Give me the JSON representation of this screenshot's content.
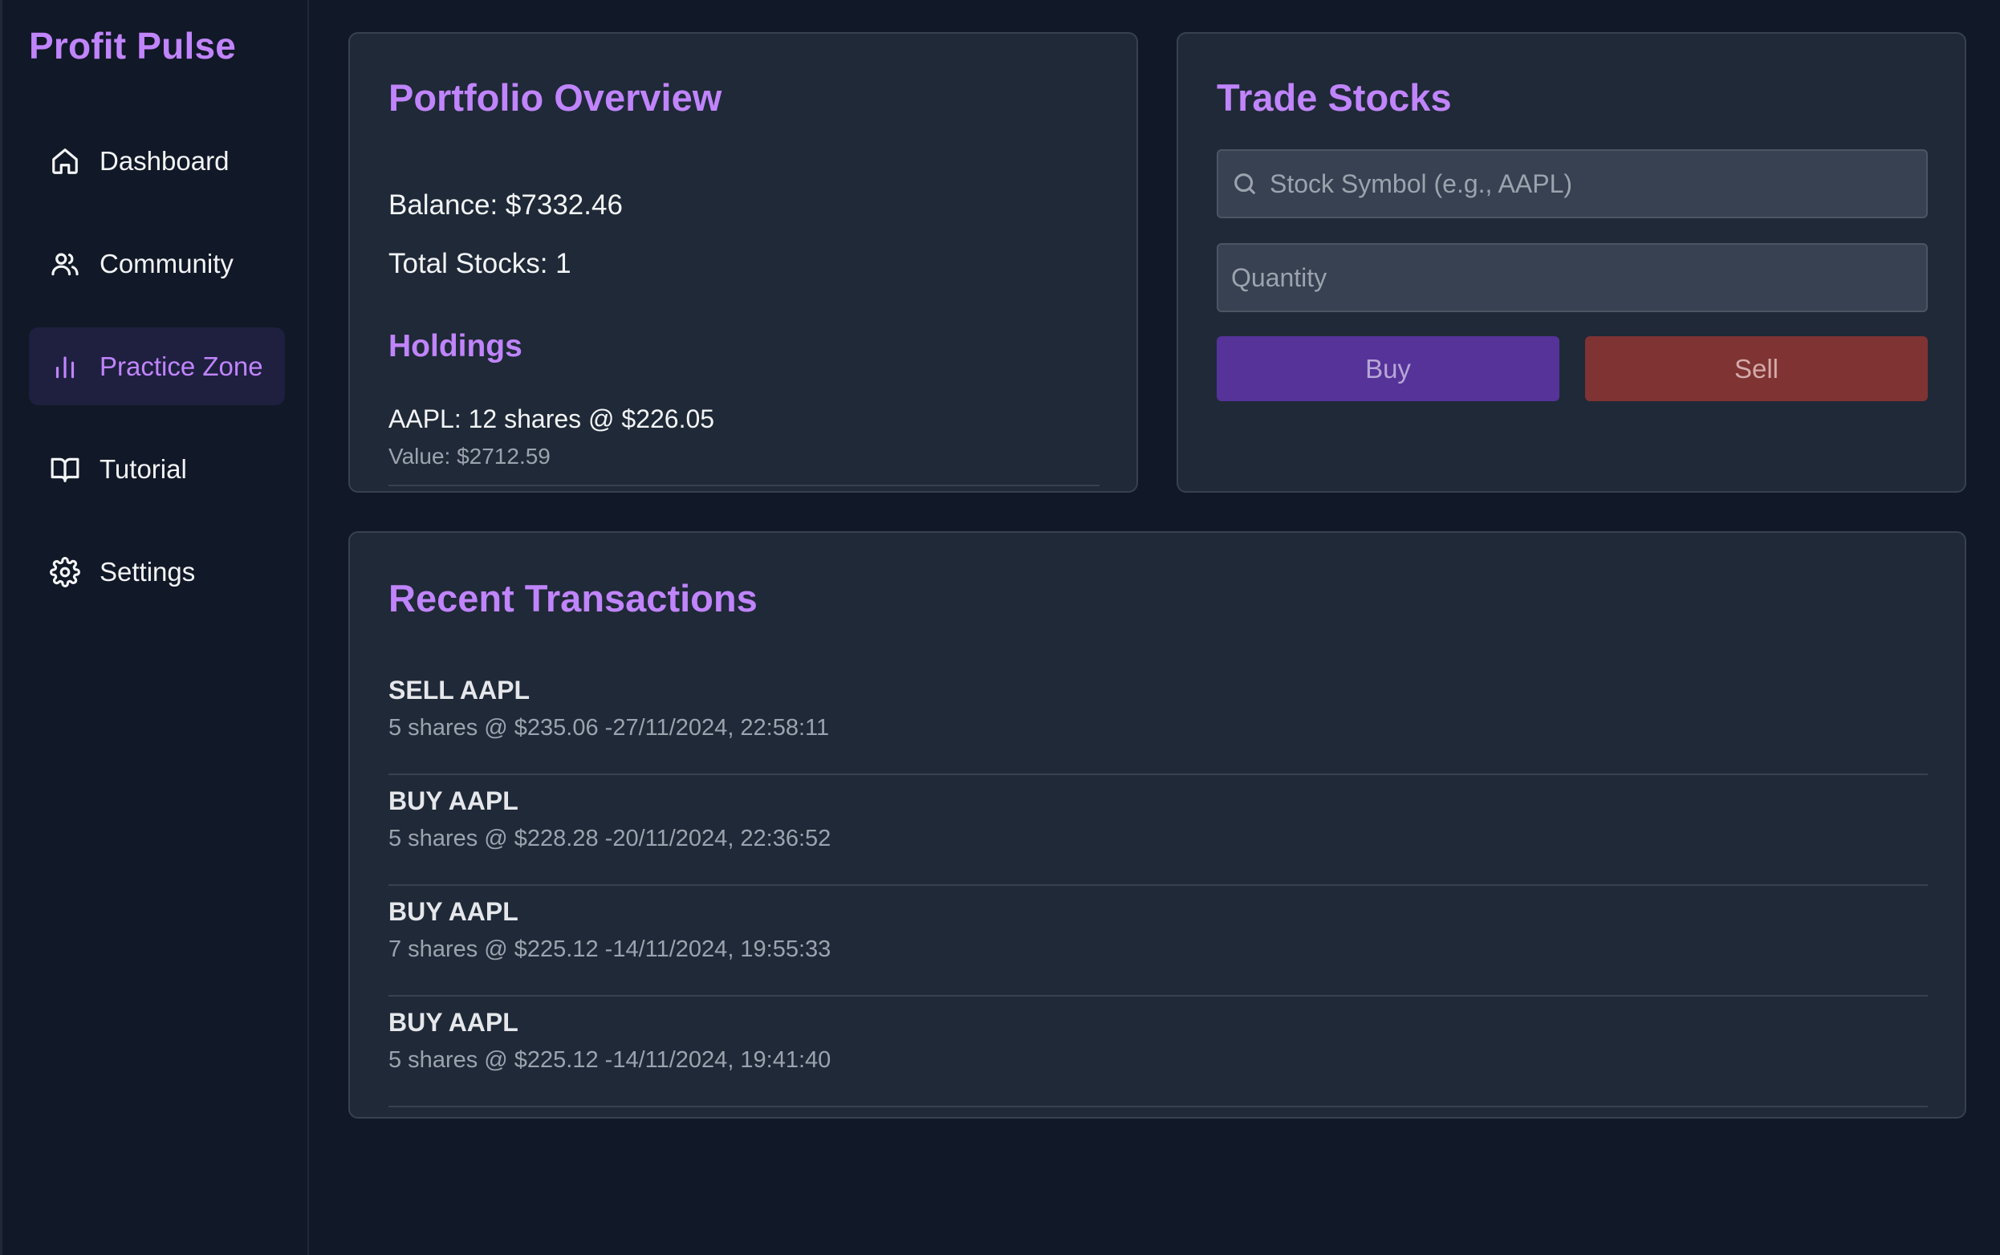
{
  "app": {
    "title": "Profit Pulse"
  },
  "sidebar": {
    "items": [
      {
        "label": "Dashboard",
        "icon": "home-icon",
        "active": false
      },
      {
        "label": "Community",
        "icon": "users-icon",
        "active": false
      },
      {
        "label": "Practice Zone",
        "icon": "bar-chart-icon",
        "active": true
      },
      {
        "label": "Tutorial",
        "icon": "book-open-icon",
        "active": false
      },
      {
        "label": "Settings",
        "icon": "gear-icon",
        "active": false
      }
    ]
  },
  "portfolio": {
    "title": "Portfolio Overview",
    "balance": "Balance: $7332.46",
    "total_stocks": "Total Stocks: 1",
    "holdings_title": "Holdings",
    "holdings": [
      {
        "line": "AAPL: 12 shares @ $226.05",
        "value": "Value: $2712.59"
      }
    ]
  },
  "trade": {
    "title": "Trade Stocks",
    "symbol_placeholder": "Stock Symbol (e.g., AAPL)",
    "symbol_value": "",
    "quantity_placeholder": "Quantity",
    "quantity_value": "",
    "buy_label": "Buy",
    "sell_label": "Sell"
  },
  "transactions": {
    "title": "Recent Transactions",
    "items": [
      {
        "type": "SELL AAPL",
        "detail": "5 shares @ $235.06 -27/11/2024, 22:58:11"
      },
      {
        "type": "BUY AAPL",
        "detail": "5 shares @ $228.28 -20/11/2024, 22:36:52"
      },
      {
        "type": "BUY AAPL",
        "detail": "7 shares @ $225.12 -14/11/2024, 19:55:33"
      },
      {
        "type": "BUY AAPL",
        "detail": "5 shares @ $225.12 -14/11/2024, 19:41:40"
      }
    ]
  },
  "colors": {
    "background": "#111827",
    "card": "#1f2937",
    "accent": "#c084fc",
    "buy": "#553399",
    "sell": "#7f3333"
  }
}
